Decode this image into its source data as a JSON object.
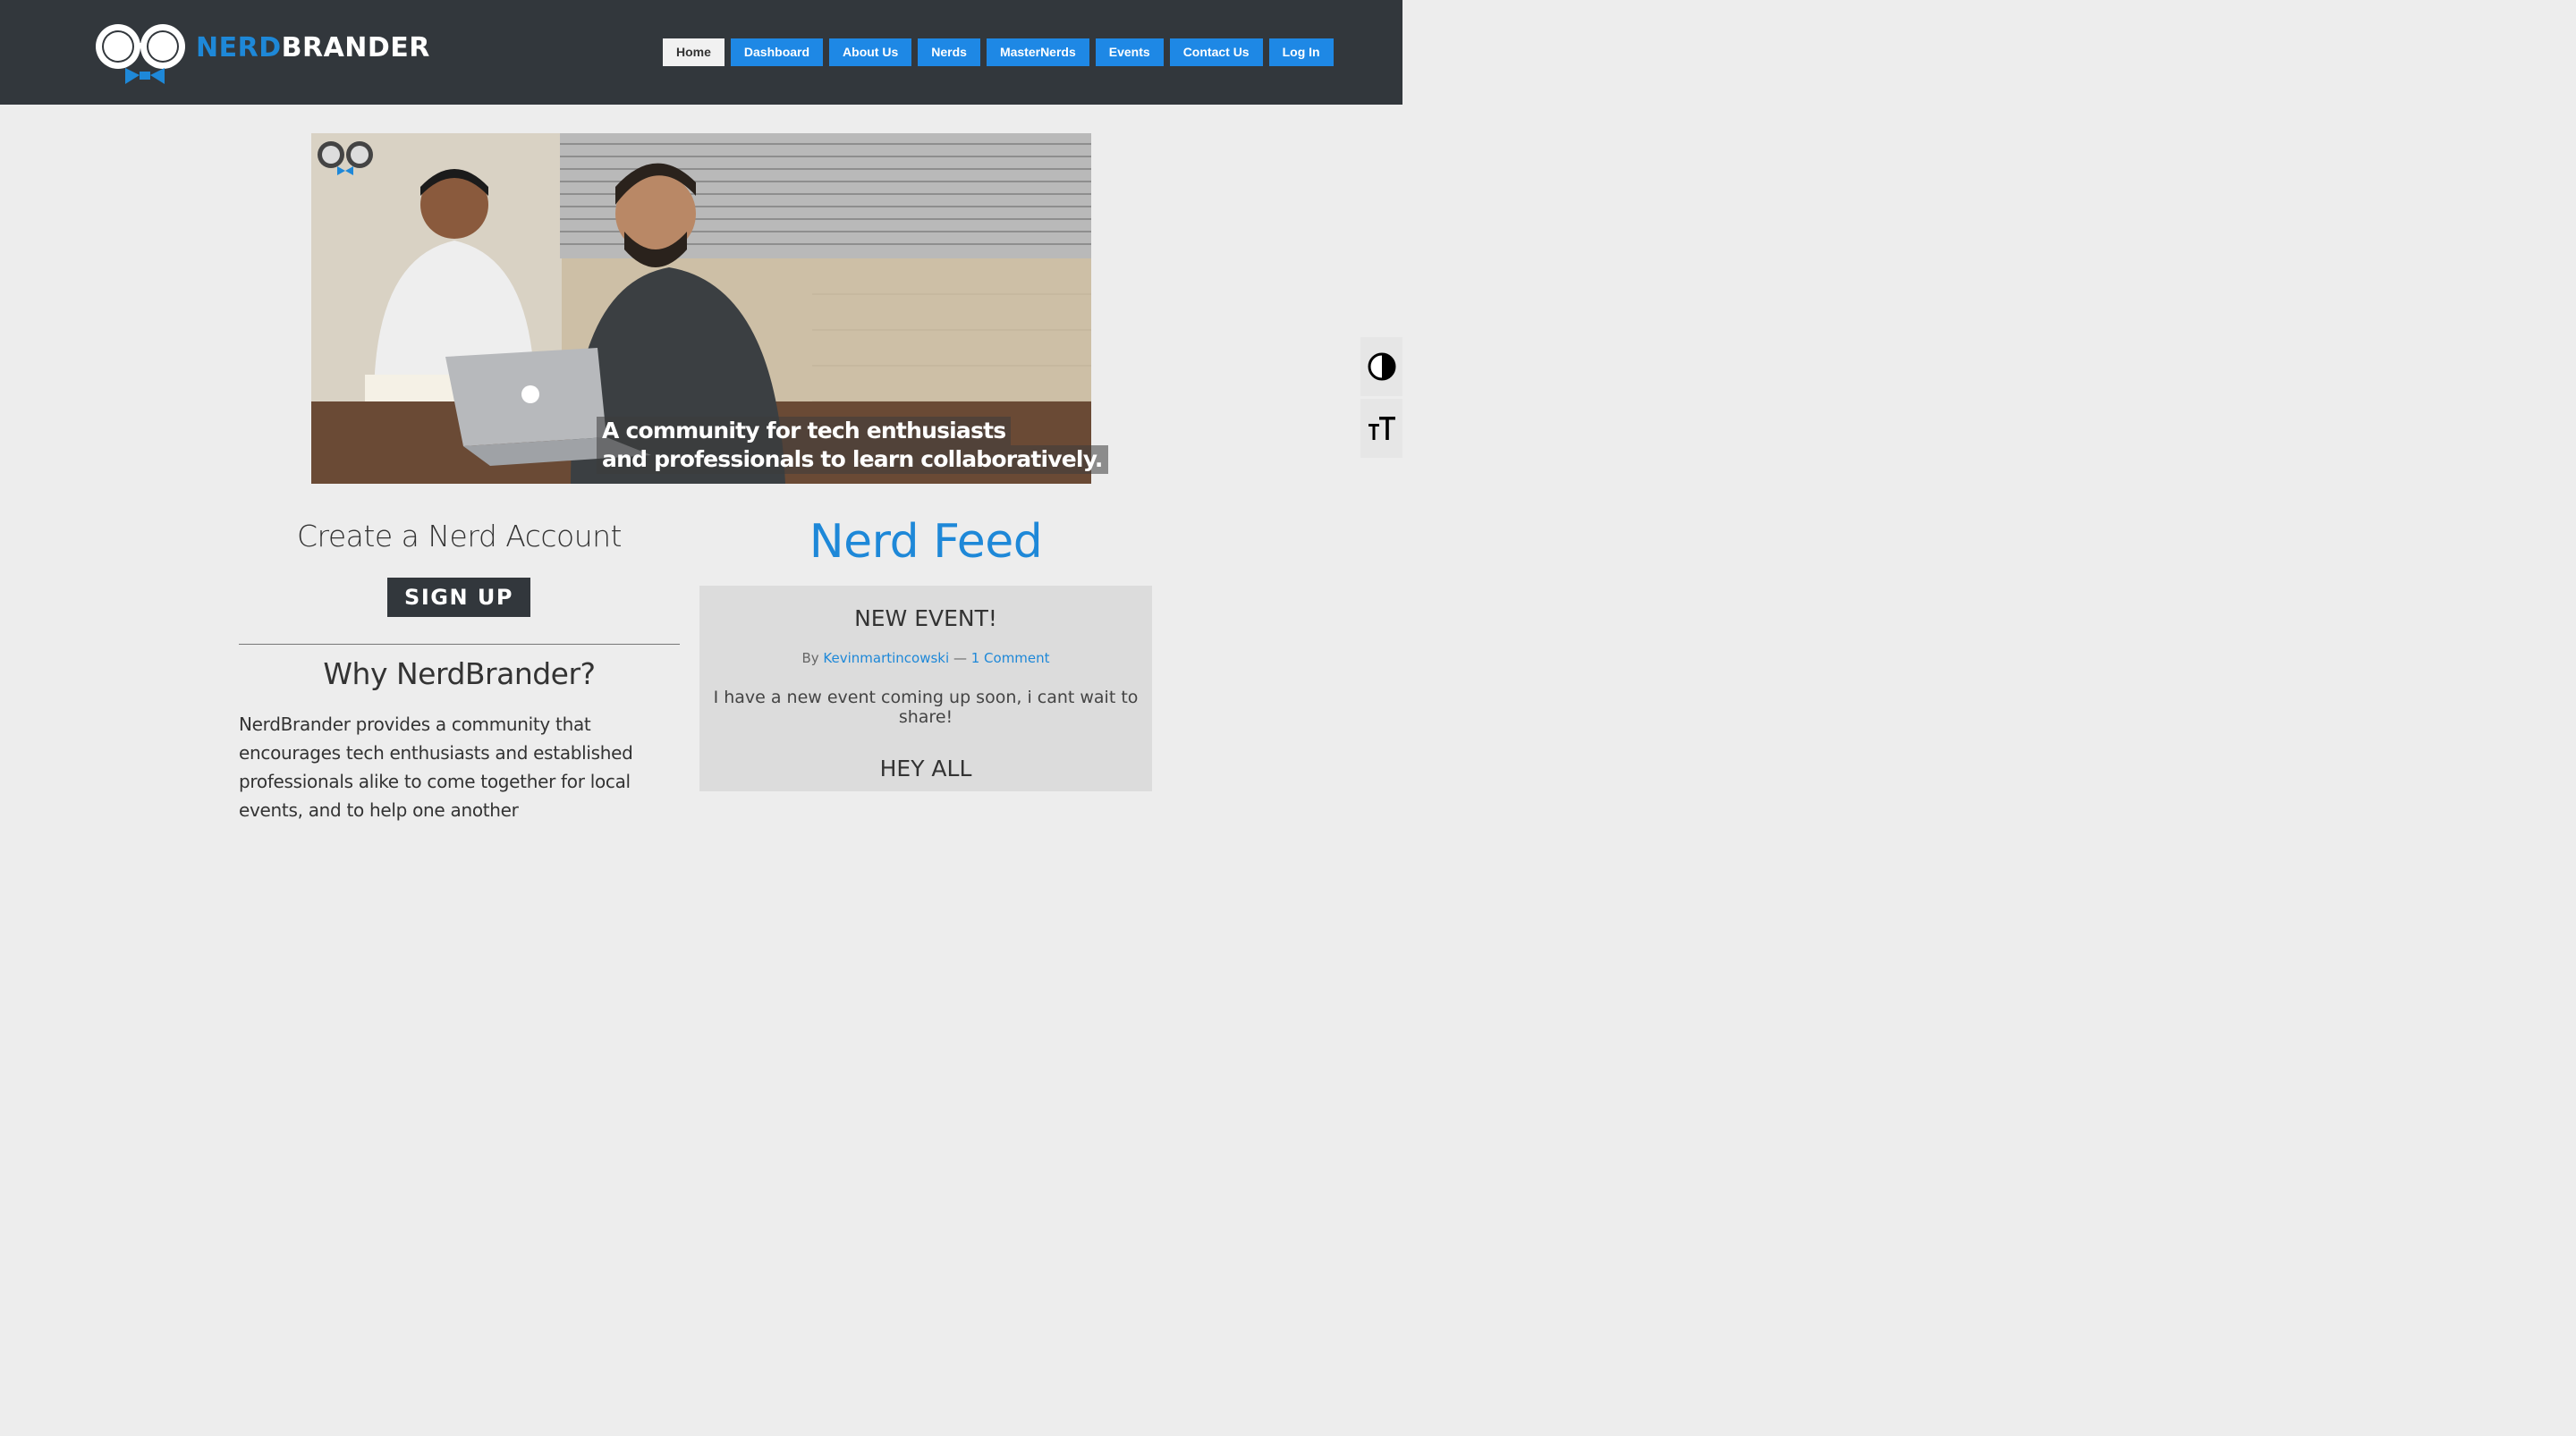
{
  "brand": {
    "part1": "NERD",
    "part2": "BRANDER"
  },
  "nav": {
    "items": [
      {
        "label": "Home",
        "active": true
      },
      {
        "label": "Dashboard"
      },
      {
        "label": "About Us"
      },
      {
        "label": "Nerds"
      },
      {
        "label": "MasterNerds"
      },
      {
        "label": "Events"
      },
      {
        "label": "Contact Us"
      },
      {
        "label": "Log In"
      }
    ]
  },
  "hero": {
    "caption_line1": "A community for tech enthusiasts",
    "caption_line2": "and professionals to learn collaboratively."
  },
  "left": {
    "create_title": "Create a Nerd Account",
    "signup_label": "SIGN UP",
    "why_title": "Why NerdBrander?",
    "why_body": "NerdBrander provides a community that encourages tech enthusiasts and established professionals alike to come together for local events, and to help one another"
  },
  "feed": {
    "title": "Nerd Feed",
    "posts": [
      {
        "title": "NEW EVENT!",
        "by": "By",
        "author": "Kevinmartincowski",
        "sep": "—",
        "comments": "1 Comment",
        "excerpt": "I have a new event coming up soon, i cant wait to share!"
      },
      {
        "title": "HEY ALL"
      }
    ]
  },
  "a11y": {
    "contrast_icon": "contrast-icon",
    "font_size_icon": "font-size-icon"
  },
  "colors": {
    "header_bg": "#32373c",
    "accent": "#1e88e5",
    "page_bg": "#ededed"
  }
}
